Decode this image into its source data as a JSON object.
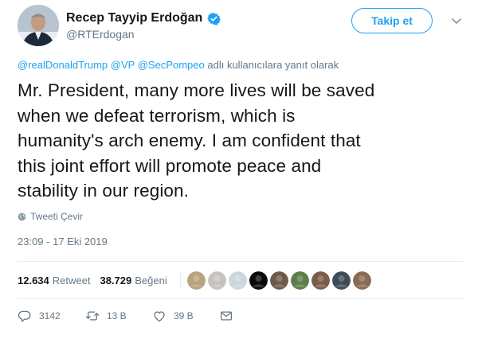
{
  "user": {
    "name": "Recep Tayyip Erdoğan",
    "handle": "@RTErdogan"
  },
  "follow_button": "Takip et",
  "reply_context": {
    "mentions": [
      "@realDonaldTrump",
      "@VP",
      "@SecPompeo"
    ],
    "suffix": "adlı kullanıcılara yanıt olarak"
  },
  "tweet": {
    "lines": [
      "Mr. President, many more lives will be saved",
      "when we defeat terrorism, which is",
      "humanity's arch enemy. I am confident that",
      "this joint effort will promote peace and",
      "stability in our region."
    ],
    "translate_label": "Tweeti Çevir",
    "timestamp": "23:09 - 17 Eki 2019"
  },
  "stats": {
    "retweets_count": "12.634",
    "retweets_label": "Retweet",
    "likes_count": "38.729",
    "likes_label": "Beğeni"
  },
  "likers": [
    {
      "name": "liker-avatar-1",
      "color": "#b9a27e"
    },
    {
      "name": "liker-avatar-2",
      "color": "#c7c2bf"
    },
    {
      "name": "liker-avatar-3",
      "color": "#ccd6dd"
    },
    {
      "name": "liker-avatar-4",
      "color": "#0a0a0a"
    },
    {
      "name": "liker-avatar-5",
      "color": "#6e5a4a"
    },
    {
      "name": "liker-avatar-6",
      "color": "#5e7d4a"
    },
    {
      "name": "liker-avatar-7",
      "color": "#7a5c48"
    },
    {
      "name": "liker-avatar-8",
      "color": "#3e4c58"
    },
    {
      "name": "liker-avatar-9",
      "color": "#8b6a52"
    }
  ],
  "actions": {
    "replies": "3142",
    "retweets": "13 B",
    "likes": "39 B"
  },
  "colors": {
    "brand_blue": "#1da1f2",
    "secondary_text": "#657786",
    "primary_text": "#14171a",
    "divider": "#e6ecf0"
  }
}
